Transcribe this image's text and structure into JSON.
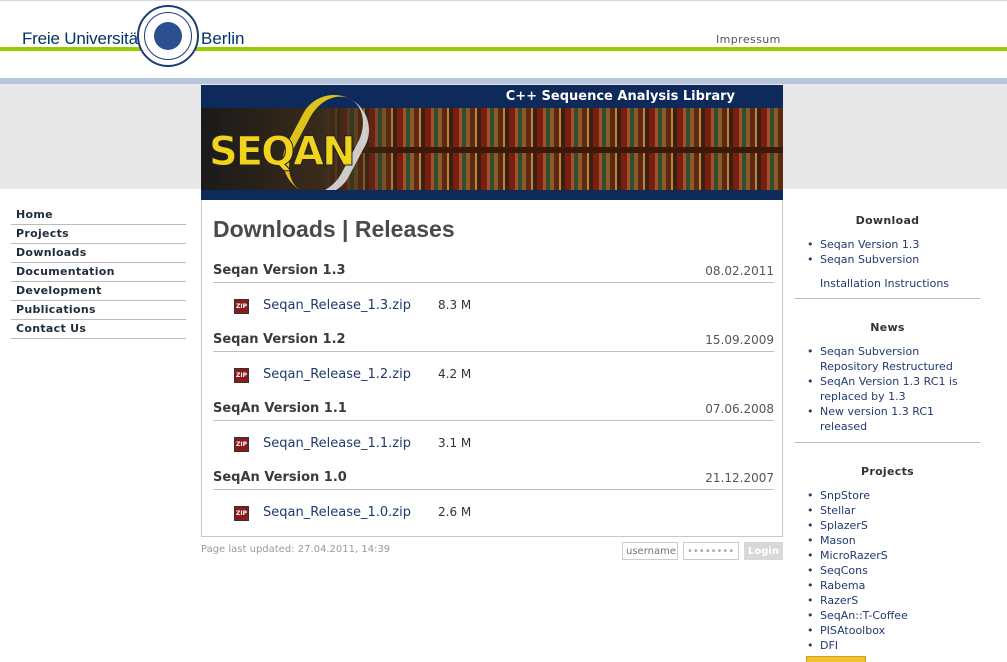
{
  "header": {
    "university_left": "Freie Universität",
    "university_right": "Berlin",
    "impressum": "Impressum"
  },
  "banner": {
    "tagline": "C++ Sequence Analysis Library",
    "logo_text": "SEQAN"
  },
  "nav": {
    "items": [
      {
        "label": "Home"
      },
      {
        "label": "Projects"
      },
      {
        "label": "Downloads"
      },
      {
        "label": "Documentation"
      },
      {
        "label": "Development"
      },
      {
        "label": "Publications"
      },
      {
        "label": "Contact Us"
      }
    ]
  },
  "main": {
    "title": "Downloads | Releases",
    "releases": [
      {
        "name": "Seqan Version 1.3",
        "date": "08.02.2011",
        "file": "Seqan_Release_1.3.zip",
        "size": "8.3 M"
      },
      {
        "name": "Seqan Version 1.2",
        "date": "15.09.2009",
        "file": "Seqan_Release_1.2.zip",
        "size": "4.2 M"
      },
      {
        "name": "SeqAn Version 1.1",
        "date": "07.06.2008",
        "file": "Seqan_Release_1.1.zip",
        "size": "3.1 M"
      },
      {
        "name": "SeqAn Version 1.0",
        "date": "21.12.2007",
        "file": "Seqan_Release_1.0.zip",
        "size": "2.6 M"
      }
    ],
    "zip_icon_label": "ZIP"
  },
  "footer": {
    "last_updated": "Page last updated: 27.04.2011, 14:39",
    "username_placeholder": "username",
    "password_value": "••••••••",
    "login_label": "Login"
  },
  "sidebar": {
    "download": {
      "title": "Download",
      "items": [
        {
          "label": "Seqan Version 1.3"
        },
        {
          "label": "Seqan Subversion"
        }
      ],
      "extra": "Installation Instructions"
    },
    "news": {
      "title": "News",
      "items": [
        {
          "label": "Seqan Subversion Repository Restructured"
        },
        {
          "label": "SeqAn Version 1.3 RC1 is replaced by 1.3"
        },
        {
          "label": "New version 1.3 RC1 released"
        }
      ]
    },
    "projects": {
      "title": "Projects",
      "items": [
        {
          "label": "SnpStore"
        },
        {
          "label": "Stellar"
        },
        {
          "label": "SplazerS"
        },
        {
          "label": "Mason"
        },
        {
          "label": "MicroRazerS"
        },
        {
          "label": "SeqCons"
        },
        {
          "label": "Rabema"
        },
        {
          "label": "RazerS"
        },
        {
          "label": "SeqAn::T-Coffee"
        },
        {
          "label": "PISAtoolbox"
        },
        {
          "label": "DFI"
        }
      ]
    }
  },
  "colors": {
    "green_bar": "#99cc00",
    "blue_bar": "#b8c6dd",
    "banner_navy": "#0d2a5a",
    "logo_yellow": "#f2d31b",
    "link_blue": "#1f3a6e"
  }
}
